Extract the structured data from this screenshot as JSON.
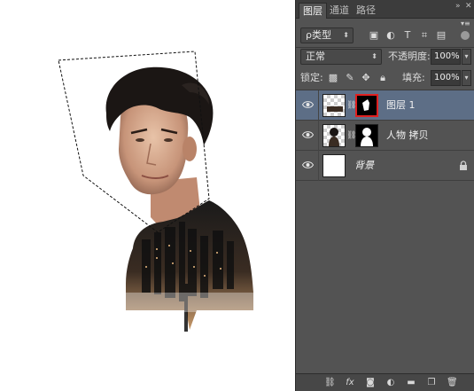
{
  "panel": {
    "tabs": [
      {
        "label": "图层",
        "active": true
      },
      {
        "label": "通道",
        "active": false
      },
      {
        "label": "路径",
        "active": false
      }
    ],
    "filter_kind": "ρ类型",
    "blend_mode": "正常",
    "opacity_label": "不透明度:",
    "opacity_value": "100%",
    "lock_label": "锁定:",
    "fill_label": "填充:",
    "fill_value": "100%",
    "layers": [
      {
        "name": "图层 1",
        "selected": true,
        "visible": true,
        "has_mask": true,
        "mask_highlighted": true
      },
      {
        "name": "人物 拷贝",
        "selected": false,
        "visible": true,
        "has_mask": true,
        "mask_highlighted": false
      },
      {
        "name": "背景",
        "selected": false,
        "visible": true,
        "has_mask": false,
        "locked": true
      }
    ],
    "colors": {
      "selected_layer": "#5d6e86",
      "panel_bg": "#535353",
      "mask_highlight": "#e02020"
    }
  },
  "icons": {
    "window_controls": [
      "collapse-icon",
      "close-icon"
    ],
    "filter_icons": [
      "image-filter-icon",
      "adjustment-filter-icon",
      "type-filter-icon",
      "shape-filter-icon",
      "smart-object-filter-icon"
    ],
    "lock_icons": [
      "lock-transparent-icon",
      "lock-paint-icon",
      "lock-position-icon",
      "lock-all-icon"
    ],
    "footer_icons": [
      "link-layers-icon",
      "fx-icon",
      "add-mask-icon",
      "adjustment-layer-icon",
      "new-group-icon",
      "new-layer-icon",
      "delete-layer-icon"
    ]
  }
}
